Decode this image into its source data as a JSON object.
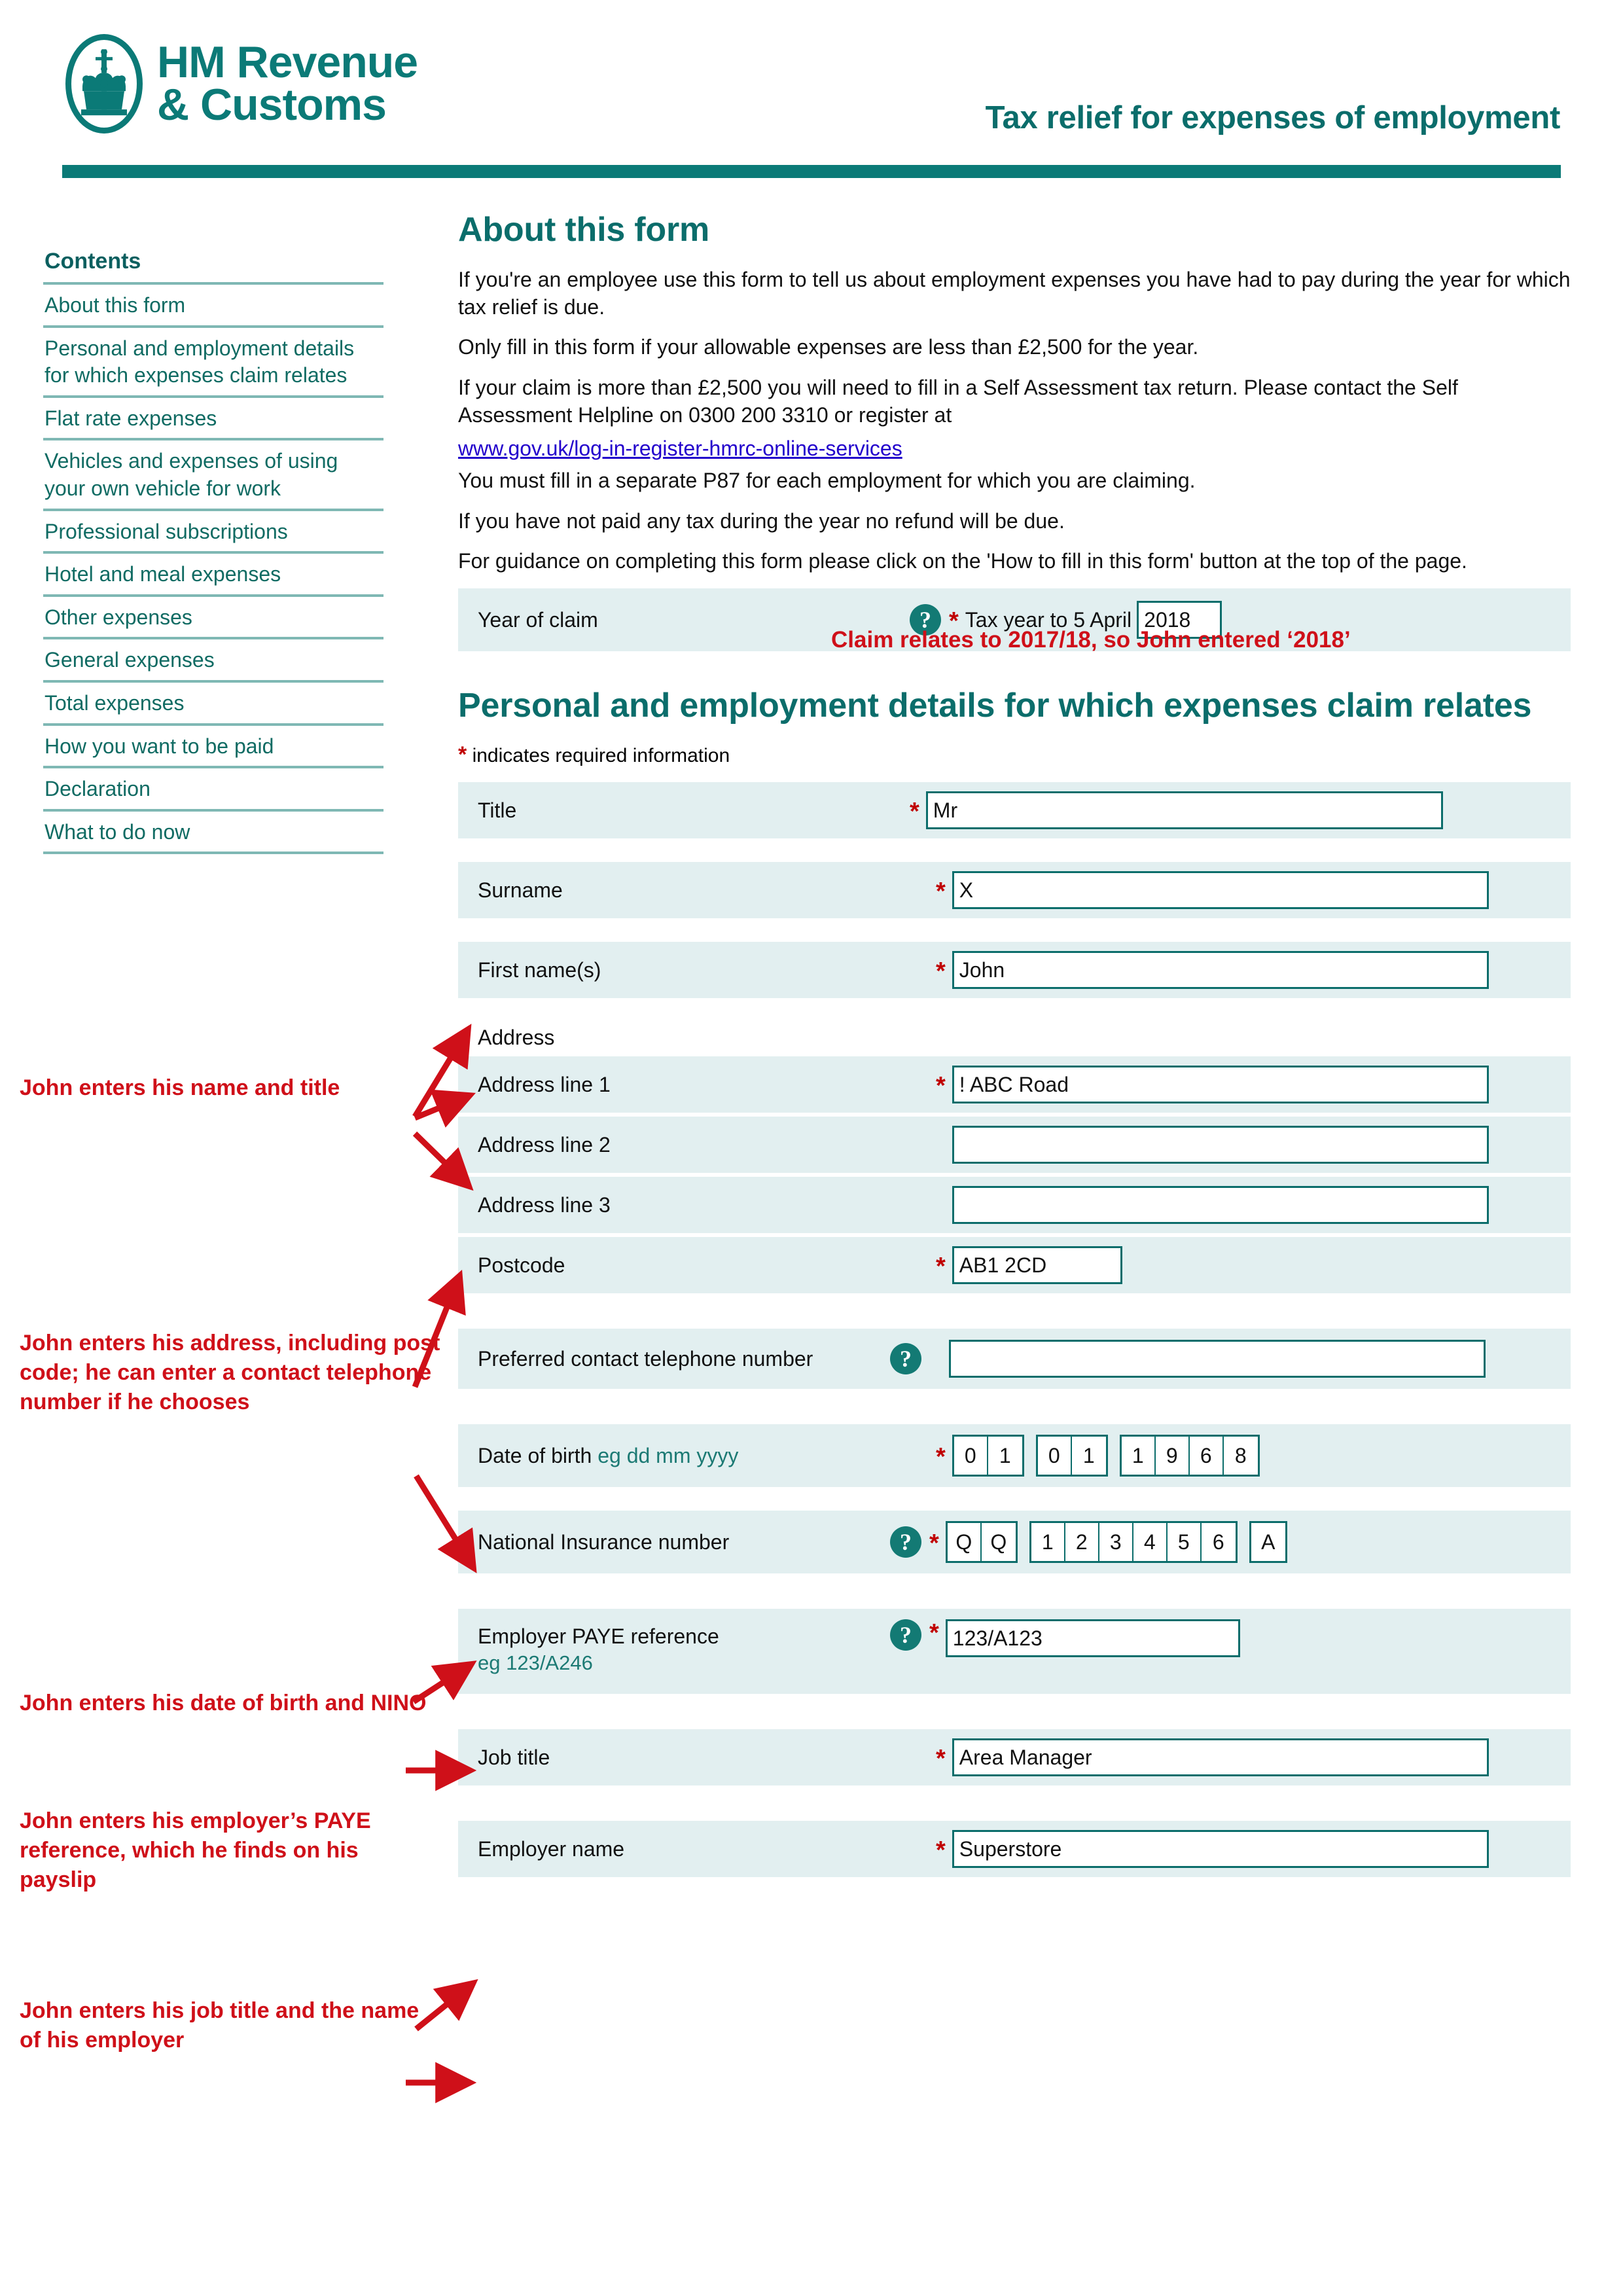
{
  "header": {
    "logo_line1": "HM Revenue",
    "logo_line2": "& Customs",
    "title": "Tax relief for expenses of employment"
  },
  "sidebar": {
    "title": "Contents",
    "items": [
      {
        "label": "About this form"
      },
      {
        "label": "Personal and employment details for which expenses claim relates"
      },
      {
        "label": "Flat rate expenses"
      },
      {
        "label": "Vehicles and expenses of using your own vehicle for work"
      },
      {
        "label": "Professional subscriptions"
      },
      {
        "label": "Hotel and meal expenses"
      },
      {
        "label": "Other expenses"
      },
      {
        "label": "General expenses"
      },
      {
        "label": "Total expenses"
      },
      {
        "label": "How you want to be paid"
      },
      {
        "label": "Declaration"
      },
      {
        "label": "What to do now"
      }
    ]
  },
  "about": {
    "heading": "About this form",
    "p1": "If you're an employee use this form to tell us about employment expenses you have had to pay during the year for which tax relief is due.",
    "p2": "Only fill in this form if your allowable expenses are less than £2,500 for the year.",
    "p3": "If your claim is more than £2,500 you will need to fill in a Self Assessment tax return. Please contact the Self Assessment Helpline on 0300 200 3310 or register at",
    "link": "www.gov.uk/log-in-register-hmrc-online-services",
    "p4": "You must fill in a separate P87 for each employment for which you are claiming.",
    "p5": "If you have not paid any tax during the year no refund will be due.",
    "p6": "For guidance on completing this form please click on the 'How to fill in this form' button at the top of the page."
  },
  "year_of_claim": {
    "label": "Year of claim",
    "help_icon": "question-mark-icon",
    "required_star": "*",
    "inline_label": "Tax year to 5 April",
    "value": "2018"
  },
  "personal": {
    "heading": "Personal and employment details for which expenses claim relates",
    "required_note_star": "*",
    "required_note": "indicates required information",
    "title_label": "Title",
    "title_value": "Mr",
    "surname_label": "Surname",
    "surname_value": "X",
    "firstname_label": "First name(s)",
    "firstname_value": "John",
    "address_heading": "Address",
    "address1_label": "Address line 1",
    "address1_value": "! ABC Road",
    "address2_label": "Address line 2",
    "address2_value": "",
    "address3_label": "Address line 3",
    "address3_value": "",
    "postcode_label": "Postcode",
    "postcode_value": "AB1 2CD",
    "phone_label": "Preferred contact telephone number",
    "phone_value": "",
    "dob_label": "Date of birth",
    "dob_hint": "eg dd mm yyyy",
    "dob_day": [
      "0",
      "1"
    ],
    "dob_month": [
      "0",
      "1"
    ],
    "dob_year": [
      "1",
      "9",
      "6",
      "8"
    ],
    "nino_label": "National Insurance number",
    "nino_prefix": [
      "Q",
      "Q"
    ],
    "nino_digits": [
      "1",
      "2",
      "3",
      "4",
      "5",
      "6"
    ],
    "nino_suffix": [
      "A"
    ],
    "paye_label": "Employer PAYE reference",
    "paye_hint": "eg 123/A246",
    "paye_value": "123/A123",
    "job_label": "Job title",
    "job_value": "Area Manager",
    "employer_label": "Employer name",
    "employer_value": "Superstore"
  },
  "annotations": {
    "year": "Claim relates to 2017/18, so John entered ‘2018’",
    "name": "John enters his name and title",
    "address": "John enters his address, including post code; he can enter a contact telephone number if he chooses",
    "dob": "John enters his date of birth and NINO",
    "paye": "John enters his employer’s PAYE reference, which he finds on his payslip",
    "job": "John enters his job title and the name of his employer"
  },
  "colors": {
    "brand_teal": "#0b7a77",
    "heading_teal": "#0b6d6b",
    "row_bg": "#e2eff0",
    "annotation_red": "#cf1019",
    "required_red": "#c00000",
    "link_blue": "#2200cc"
  }
}
